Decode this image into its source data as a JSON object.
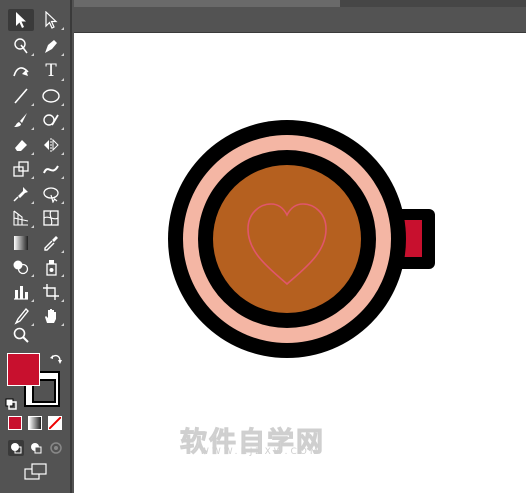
{
  "colors": {
    "panel": "#535353",
    "canvas": "#ffffff",
    "mug_rim": "#f4b6a4",
    "coffee": "#b5601f",
    "heart_stroke": "#e0566b",
    "handle_red": "#c8102e",
    "fill_color": "#c8102e"
  },
  "toolbar": {
    "icons": [
      "selection-tool-icon",
      "direct-selection-tool-icon",
      "magic-wand-icon",
      "pen-tool-icon",
      "curvature-tool-icon",
      "type-tool-icon",
      "line-segment-tool-icon",
      "ellipse-tool-icon",
      "paintbrush-tool-icon",
      "shaper-tool-icon",
      "eraser-tool-icon",
      "reflect-tool-icon",
      "scale-tool-icon",
      "width-tool-icon",
      "puppet-warp-tool-icon",
      "free-transform-tool-icon",
      "perspective-grid-tool-icon",
      "mesh-tool-icon",
      "gradient-tool-icon",
      "eyedropper-tool-icon",
      "shape-builder-tool-icon",
      "symbol-sprayer-tool-icon",
      "column-graph-tool-icon",
      "artboard-tool-icon",
      "slice-tool-icon",
      "hand-tool-icon",
      "zoom-tool-icon"
    ],
    "type_tool_glyph": "T"
  },
  "watermark": {
    "text": "软件自学网",
    "url": "WWW.RJZXW.COM"
  }
}
